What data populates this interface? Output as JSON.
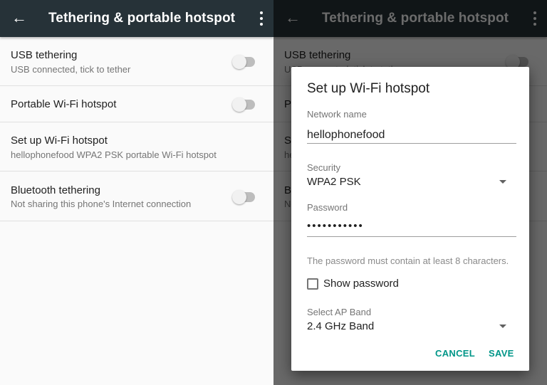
{
  "appbar": {
    "title": "Tethering & portable hotspot",
    "back_icon": "arrow-left-icon",
    "menu_icon": "more-vert-icon"
  },
  "settings": [
    {
      "title": "USB tethering",
      "subtitle": "USB connected, tick to tether",
      "toggle": false
    },
    {
      "title": "Portable Wi-Fi hotspot",
      "toggle": false
    },
    {
      "title": "Set up Wi-Fi hotspot",
      "subtitle": "hellophonefood WPA2 PSK portable Wi-Fi hotspot"
    },
    {
      "title": "Bluetooth tethering",
      "subtitle": "Not sharing this phone's Internet connection",
      "toggle": false
    }
  ],
  "dialog": {
    "title": "Set up Wi-Fi hotspot",
    "network_label": "Network name",
    "network_value": "hellophonefood",
    "security_label": "Security",
    "security_value": "WPA2 PSK",
    "password_label": "Password",
    "password_value": "•••••••••••",
    "hint": "The password must contain at least 8 characters.",
    "show_password": "Show password",
    "show_password_checked": false,
    "band_label": "Select AP Band",
    "band_value": "2.4 GHz Band",
    "cancel": "CANCEL",
    "save": "SAVE"
  },
  "colors": {
    "appbar": "#263238",
    "accent": "#009688",
    "background": "#fafafa"
  }
}
